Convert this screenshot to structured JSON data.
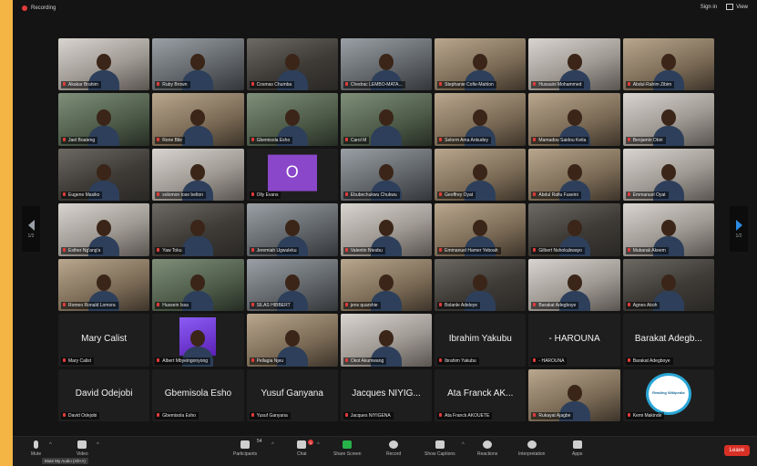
{
  "topbar": {
    "recording": "Recording",
    "sign_in": "Sign in",
    "view": "View"
  },
  "pagination": {
    "left": "1/2",
    "right": "1/2"
  },
  "tiles": [
    {
      "name": "Akakar Brahim",
      "style": "video v4"
    },
    {
      "name": "Ruby Brown",
      "style": "video v1"
    },
    {
      "name": "Cosmas Chumba",
      "style": "video"
    },
    {
      "name": "Chedrac LEMBO-MATA...",
      "style": "video v1"
    },
    {
      "name": "Stephanie Cofie-Mahlon",
      "style": "video v2"
    },
    {
      "name": "Hussaini Mohammed",
      "style": "video v4"
    },
    {
      "name": "Abdul-Rahim Zibim",
      "style": "video v2"
    },
    {
      "name": "Jael Boateng",
      "style": "video v3"
    },
    {
      "name": "Rene Bile",
      "style": "video v2"
    },
    {
      "name": "Gbemisola Esho",
      "style": "video v3"
    },
    {
      "name": "Carol M",
      "style": "video v3"
    },
    {
      "name": "Selorm Ama Ankudey",
      "style": "video v2"
    },
    {
      "name": "Mamadou Saidou Keita",
      "style": "video v2"
    },
    {
      "name": "Benjamin Obiri",
      "style": "video v4"
    },
    {
      "name": "Eugene Masiko",
      "style": "video"
    },
    {
      "name": "solomon tose belton",
      "style": "video v4"
    },
    {
      "name": "Olly Evans",
      "initial": "O",
      "style": "dark"
    },
    {
      "name": "Ebubechukwu Chukwu",
      "style": "video v1"
    },
    {
      "name": "Geoffrey Oyat",
      "style": "video v2"
    },
    {
      "name": "Abdul Rafiu Fuseini",
      "style": "video v2"
    },
    {
      "name": "Emmanuel Oyat",
      "style": "video v4"
    },
    {
      "name": "Esther Ng'ang'a",
      "style": "video v4"
    },
    {
      "name": "Yaw Toku",
      "style": "video"
    },
    {
      "name": "Jeremiah Ugwuleku",
      "style": "video v1"
    },
    {
      "name": "Valentin Ntesbu",
      "style": "video v4"
    },
    {
      "name": "Emmanuel Hamer Yeboah",
      "style": "video v2"
    },
    {
      "name": "Gilbert Nshokubwayo",
      "style": "video"
    },
    {
      "name": "Mubarak Akeem",
      "style": "video v4"
    },
    {
      "name": "Romeo Ronald Lomora",
      "style": "video v2"
    },
    {
      "name": "Hussein Issa",
      "style": "video v3"
    },
    {
      "name": "SILAS HIBBERT",
      "style": "video v1"
    },
    {
      "name": "jens quarshie",
      "style": "video v2"
    },
    {
      "name": "Bolanle Adeleye",
      "style": "video"
    },
    {
      "name": "Barakat Adegboye",
      "style": "video v4"
    },
    {
      "name": "Agnes Akoh",
      "style": "video"
    },
    {
      "name": "Mary Calist",
      "big": "Mary Calist",
      "style": "dark"
    },
    {
      "name": "Albert Mbyeingonyong",
      "style": "dark",
      "purple": true
    },
    {
      "name": "Pellagia Njeu",
      "style": "video v2"
    },
    {
      "name": "Okot Akumwang",
      "style": "video v4"
    },
    {
      "name": "Ibrahim Yakubu",
      "big": "Ibrahim Yakubu",
      "style": "dark"
    },
    {
      "name": "- HAROUNA",
      "big": "- HAROUNA",
      "style": "dark"
    },
    {
      "name": "Barakat Adegboye",
      "big": "Barakat Adegb...",
      "style": "dark"
    },
    {
      "name": "David Odejobi",
      "big": "David Odejobi",
      "style": "dark"
    },
    {
      "name": "Gbemisola Esho",
      "big": "Gbemisola Esho",
      "style": "dark"
    },
    {
      "name": "Yusuf Ganyana",
      "big": "Yusuf Ganyana",
      "style": "dark"
    },
    {
      "name": "Jacques NIYIGENA",
      "big": "Jacques NIYIG...",
      "style": "dark"
    },
    {
      "name": "Ata Franck AKOUETE",
      "big": "Ata Franck AK...",
      "style": "dark"
    },
    {
      "name": "Rukayat Ajagbe",
      "style": "video v2"
    },
    {
      "name": "Kemi Makinde",
      "logo": "Reading Wikipedia",
      "style": "dark"
    }
  ],
  "toolbar": {
    "mute": "Mute",
    "tooltip": "Mute My Audio (Alt+A)",
    "video": "Video",
    "participants": "Participants",
    "participants_count": "54",
    "chat": "Chat",
    "chat_badge": "1",
    "share": "Share Screen",
    "record": "Record",
    "captions": "Show Captions",
    "reactions": "Reactions",
    "interpretation": "Interpretation",
    "apps": "Apps",
    "leave": "Leave"
  }
}
